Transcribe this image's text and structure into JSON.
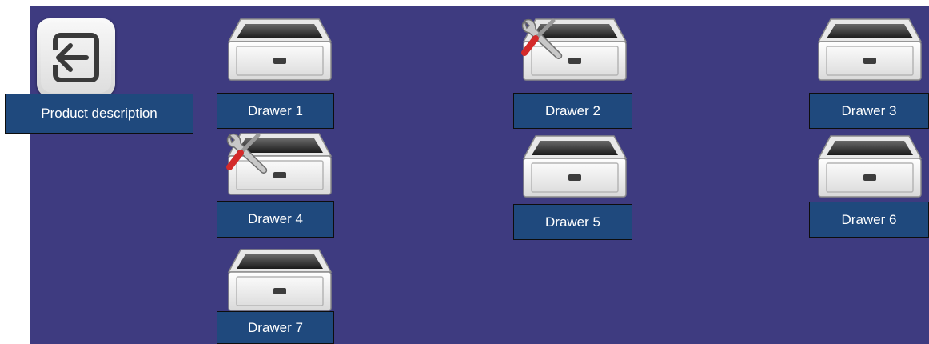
{
  "product_description_label": "Product description",
  "back_icon": "exit-arrow-icon",
  "drawers": [
    {
      "label": "Drawer 1",
      "maintenance_icon": false
    },
    {
      "label": "Drawer 2",
      "maintenance_icon": true
    },
    {
      "label": "Drawer 3",
      "maintenance_icon": false
    },
    {
      "label": "Drawer 4",
      "maintenance_icon": true
    },
    {
      "label": "Drawer 5",
      "maintenance_icon": false
    },
    {
      "label": "Drawer 6",
      "maintenance_icon": false
    },
    {
      "label": "Drawer 7",
      "maintenance_icon": false
    }
  ],
  "colors": {
    "panel": "#3e3b80",
    "label_bg": "#1f497d",
    "label_text": "#ffffff"
  }
}
